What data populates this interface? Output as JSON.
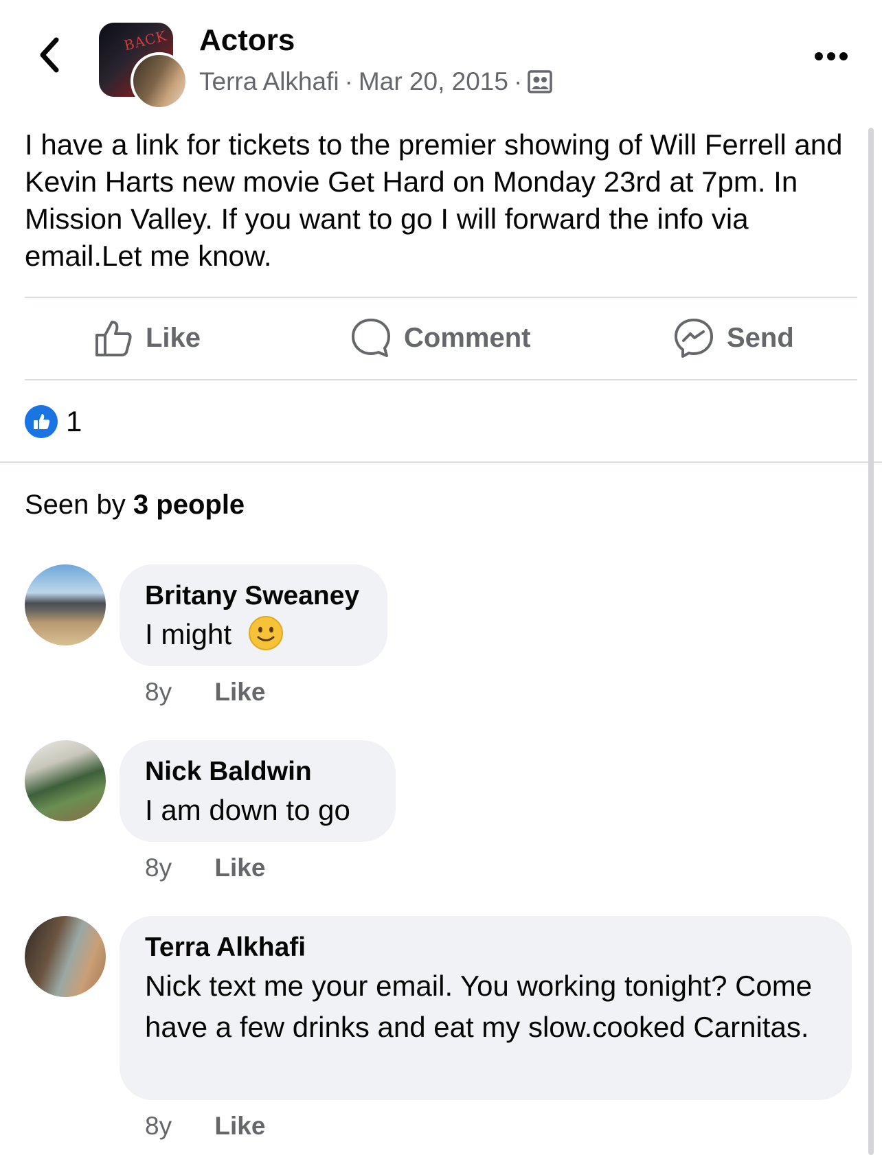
{
  "header": {
    "group_name": "Actors",
    "author": "Terra Alkhafi",
    "separator": "·",
    "date": "Mar 20, 2015",
    "audience_icon": "group-members-icon",
    "back_icon": "chevron-left-icon",
    "more_icon": "more-horizontal-icon"
  },
  "post": {
    "text": "I have a link for tickets to the premier showing of Will Ferrell and Kevin Harts new movie Get Hard on Monday 23rd at 7pm. In Mission Valley. If you want to go I will forward the info via email.Let me know."
  },
  "actions": {
    "like": "Like",
    "comment": "Comment",
    "send": "Send"
  },
  "reactions": {
    "count": "1",
    "icon": "thumbs-up-icon",
    "color": "#1b74e4"
  },
  "seen": {
    "prefix": "Seen by",
    "count": "3 people"
  },
  "comments": [
    {
      "name": "Britany Sweaney",
      "text": "I might",
      "emoji": "slightly-smiling-face-icon",
      "age": "8y",
      "like": "Like"
    },
    {
      "name": "Nick Baldwin",
      "text": "I am down to go",
      "age": "8y",
      "like": "Like"
    },
    {
      "name": "Terra Alkhafi",
      "text": "Nick text me your email. You working tonight? Come have a few drinks and eat my slow.cooked Carnitas.",
      "age": "8y",
      "like": "Like"
    }
  ],
  "colors": {
    "secondary_text": "#65676b",
    "bubble": "#f0f2f5",
    "divider": "#dadde1"
  }
}
